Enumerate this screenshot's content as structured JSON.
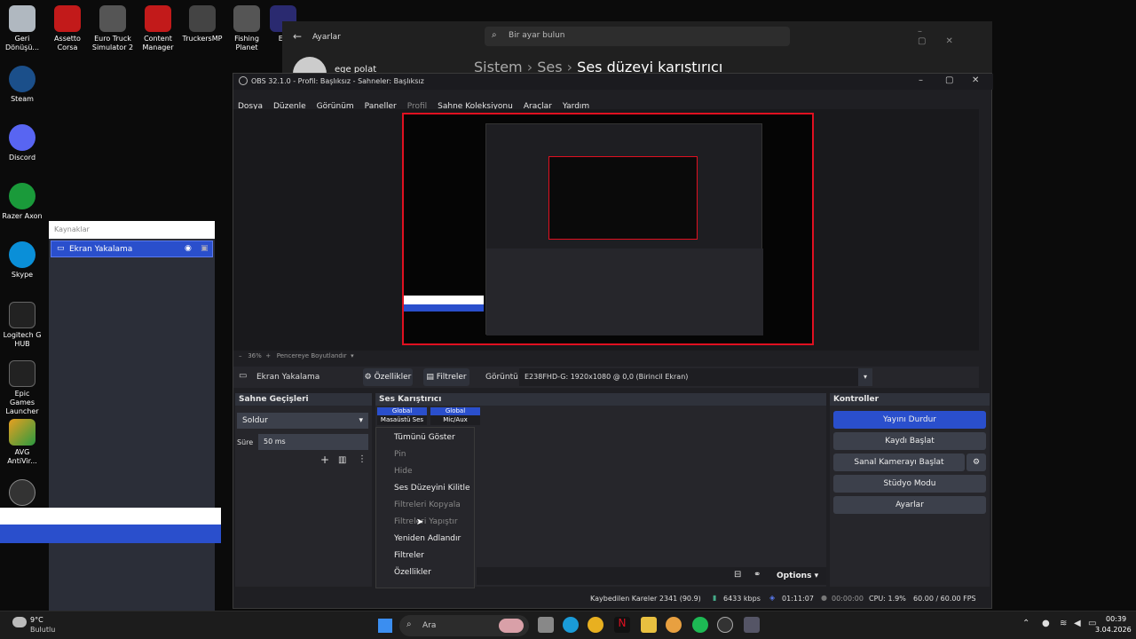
{
  "desktop": {
    "icons": [
      {
        "label": "Geri Dönüşü...",
        "color": "#b0b8c0"
      },
      {
        "label": "Steam",
        "color": "#1b4f8a"
      },
      {
        "label": "Discord",
        "color": "#5865f2"
      },
      {
        "label": "Razer Axon",
        "color": "#1a9a3a"
      },
      {
        "label": "Skype",
        "color": "#0a8fd8"
      },
      {
        "label": "Logitech G HUB",
        "color": "#222"
      },
      {
        "label": "Epic Games Launcher",
        "color": "#222"
      },
      {
        "label": "AVG AntiVir...",
        "color": "#e8a020"
      },
      {
        "label": "",
        "color": "#333"
      }
    ],
    "top_icons": [
      {
        "label": "Assetto Corsa",
        "color": "#c21a1a"
      },
      {
        "label": "Euro Truck Simulator 2",
        "color": "#555"
      },
      {
        "label": "Content Manager",
        "color": "#c21a1a"
      },
      {
        "label": "TruckersMP",
        "color": "#444"
      },
      {
        "label": "Fishing Planet",
        "color": "#555"
      },
      {
        "label": "EA",
        "color": "#2a2a70"
      }
    ]
  },
  "settings": {
    "back_label": "Ayarlar",
    "search_placeholder": "Bir ayar bulun",
    "user": "ege polat",
    "breadcrumb": [
      "Sistem",
      "Ses",
      "Ses düzeyi karıştırıcı"
    ]
  },
  "obs": {
    "title": "OBS 32.1.0 - Profil: Başlıksız - Sahneler: Başlıksız",
    "menu": [
      "Dosya",
      "Düzenle",
      "Görünüm",
      "Paneller",
      "Profil",
      "Sahne Koleksiyonu",
      "Araçlar",
      "Yardım"
    ],
    "zoom_label": "36%",
    "zoom_mode": "Pencereye Boyutlandır",
    "source_name": "Ekran Yakalama",
    "props_btn": "Özellikler",
    "filters_btn": "Filtreler",
    "display_label": "Görüntü",
    "display_value": "E238FHD-G: 1920x1080 @ 0,0 (Birincil Ekran)",
    "transitions": {
      "title": "Sahne Geçişleri",
      "type": "Soldur",
      "duration_label": "Süre",
      "duration": "50 ms"
    },
    "mixer": {
      "title": "Ses Karıştırıcı",
      "ch1_tag": "Global",
      "ch1": "Masaüstü Ses",
      "ch2_tag": "Global",
      "ch2": "Mic/Aux"
    },
    "context_menu": [
      {
        "label": "Tümünü Göster",
        "disabled": false
      },
      {
        "label": "Pin",
        "disabled": true
      },
      {
        "label": "Hide",
        "disabled": true
      },
      {
        "label": "Ses Düzeyini Kilitle",
        "disabled": false
      },
      {
        "label": "Filtreleri Kopyala",
        "disabled": true
      },
      {
        "label": "Filtreleri Yapıştır",
        "disabled": true
      },
      {
        "label": "Yeniden Adlandır",
        "disabled": false
      },
      {
        "label": "Filtreler",
        "disabled": false
      },
      {
        "label": "Özellikler",
        "disabled": false
      }
    ],
    "controls": {
      "title": "Kontroller",
      "stop_stream": "Yayını Durdur",
      "start_rec": "Kaydı Başlat",
      "virtual_cam": "Sanal Kamerayı Başlat",
      "studio": "Stüdyo Modu",
      "settings": "Ayarlar"
    },
    "options_label": "Options",
    "status": {
      "dropped": "Kaybedilen Kareler 2341 (90.9)",
      "bitrate": "6433 kbps",
      "live_time": "01:11:07",
      "rec_time": "00:00:00",
      "cpu": "CPU: 1.9%",
      "fps": "60.00 / 60.00 FPS"
    }
  },
  "sources_panel": {
    "title": "Kaynaklar",
    "item": "Ekran Yakalama"
  },
  "taskbar": {
    "weather_temp": "9°C",
    "weather_desc": "Bulutlu",
    "search": "Ara",
    "time": "00:39",
    "date": "3.04.2026"
  }
}
